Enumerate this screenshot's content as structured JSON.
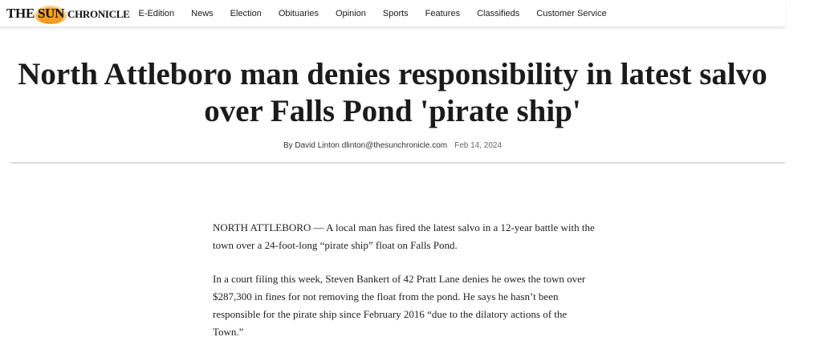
{
  "header": {
    "logo": {
      "the": "THE",
      "sun": "SUN",
      "chronicle": "CHRONICLE"
    },
    "nav": [
      "E-Edition",
      "News",
      "Election",
      "Obituaries",
      "Opinion",
      "Sports",
      "Features",
      "Classifieds",
      "Customer Service"
    ]
  },
  "article": {
    "headline": "North Attleboro man denies responsibility in latest salvo over Falls Pond 'pirate ship'",
    "byline": "By David Linton dlinton@thesunchronicle.com",
    "date": "Feb 14, 2024",
    "paragraphs": [
      "NORTH ATTLEBORO — A local man has fired the latest salvo in a 12-year battle with the town over a 24-foot-long “pirate ship” float on Falls Pond.",
      "In a court filing this week, Steven Bankert of 42 Pratt Lane denies he owes the town over $287,300 in fines for not removing the float from the pond. He says he hasn’t been responsible for the pirate ship since February 2016 “due to the dilatory actions of the Town.”"
    ]
  },
  "colors": {
    "logo_sun": "#f39a1e",
    "text": "#1b1b1b",
    "divider": "#dcdcdc"
  }
}
